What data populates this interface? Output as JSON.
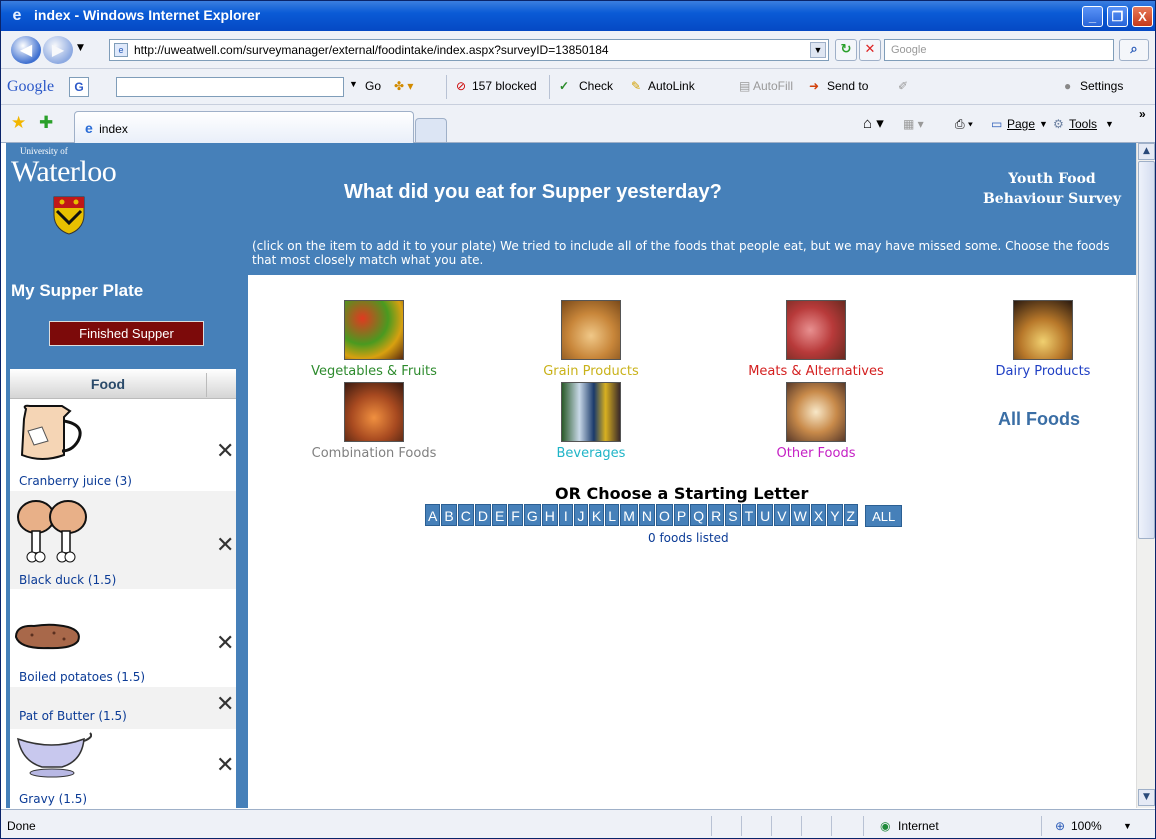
{
  "window": {
    "title": "index - Windows Internet Explorer",
    "minimize": "_",
    "restore": "❐",
    "close": "X"
  },
  "address_bar": {
    "url": "http://uweatwell.com/surveymanager/external/foodintake/index.aspx?surveyID=13850184",
    "search_placeholder": "Google"
  },
  "google_toolbar": {
    "logo": "Google",
    "go": "Go",
    "blocked": "157 blocked",
    "check": "Check",
    "autolink": "AutoLink",
    "autofill": "AutoFill",
    "send_to": "Send to",
    "settings": "Settings"
  },
  "tabs": {
    "active_tab": "index",
    "page_menu": "Page",
    "tools_menu": "Tools"
  },
  "brand": {
    "small": "University of",
    "name": "Waterloo",
    "survey_title_line1": "Youth Food",
    "survey_title_line2": "Behaviour Survey"
  },
  "main": {
    "heading": "What did you eat for Supper yesterday?",
    "instructions": "(click on the item to add it to your plate) We tried to include all of the foods that people eat, but we may have missed some. Choose the foods that most closely match what you ate.",
    "categories": [
      {
        "label": "Vegetables & Fruits",
        "color": "#2e8b2e",
        "icon": "vegetables-fruits-photo"
      },
      {
        "label": "Grain Products",
        "color": "#c9b21a",
        "icon": "grain-products-photo"
      },
      {
        "label": "Meats & Alternatives",
        "color": "#d42020",
        "icon": "meats-alternatives-photo"
      },
      {
        "label": "Dairy Products",
        "color": "#1f3fc4",
        "icon": "dairy-products-photo"
      },
      {
        "label": "Combination Foods",
        "color": "#808080",
        "icon": "combination-foods-photo"
      },
      {
        "label": "Beverages",
        "color": "#1fb4c7",
        "icon": "beverages-photo"
      },
      {
        "label": "Other Foods",
        "color": "#c41fc4",
        "icon": "other-foods-photo"
      }
    ],
    "all_foods": "All Foods",
    "or_choose": "OR Choose a Starting Letter",
    "letters": [
      "A",
      "B",
      "C",
      "D",
      "E",
      "F",
      "G",
      "H",
      "I",
      "J",
      "K",
      "L",
      "M",
      "N",
      "O",
      "P",
      "Q",
      "R",
      "S",
      "T",
      "U",
      "V",
      "W",
      "X",
      "Y",
      "Z"
    ],
    "all_letters": "ALL",
    "count_text": "0 foods listed"
  },
  "sidebar": {
    "plate_title": "My Supper Plate",
    "finished_button": "Finished Supper",
    "food_header": "Food",
    "remove_glyph": "✕",
    "items": [
      {
        "label": "Cranberry juice (3)",
        "icon": "pitcher-icon"
      },
      {
        "label": "Black duck (1.5)",
        "icon": "drumstick-icon"
      },
      {
        "label": "Boiled potatoes (1.5)",
        "icon": "potato-icon"
      },
      {
        "label": "Pat of Butter (1.5)",
        "icon": "butter-icon"
      },
      {
        "label": "Gravy (1.5)",
        "icon": "gravy-boat-icon"
      }
    ]
  },
  "statusbar": {
    "status": "Done",
    "zone": "Internet",
    "zoom": "100%"
  }
}
